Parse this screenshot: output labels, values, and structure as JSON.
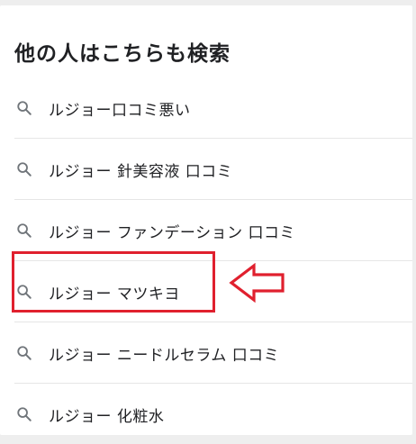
{
  "section": {
    "title": "他の人はこちらも検索"
  },
  "searches": [
    {
      "label": "ルジョー口コミ悪い",
      "icon": "search-icon"
    },
    {
      "label": "ルジョー 針美容液 口コミ",
      "icon": "search-icon"
    },
    {
      "label": "ルジョー ファンデーション 口コミ",
      "icon": "search-icon"
    },
    {
      "label": "ルジョー マツキヨ",
      "icon": "search-icon"
    },
    {
      "label": "ルジョー ニードルセラム 口コミ",
      "icon": "search-icon"
    },
    {
      "label": "ルジョー 化粧水",
      "icon": "search-icon"
    }
  ],
  "annotation": {
    "highlighted_index": 3,
    "color": "#e0202e",
    "icon": "left-arrow-icon"
  },
  "colors": {
    "text": "#202124",
    "icon": "#70757a",
    "divider": "#e6e6e6",
    "background": "#eeeeee"
  }
}
